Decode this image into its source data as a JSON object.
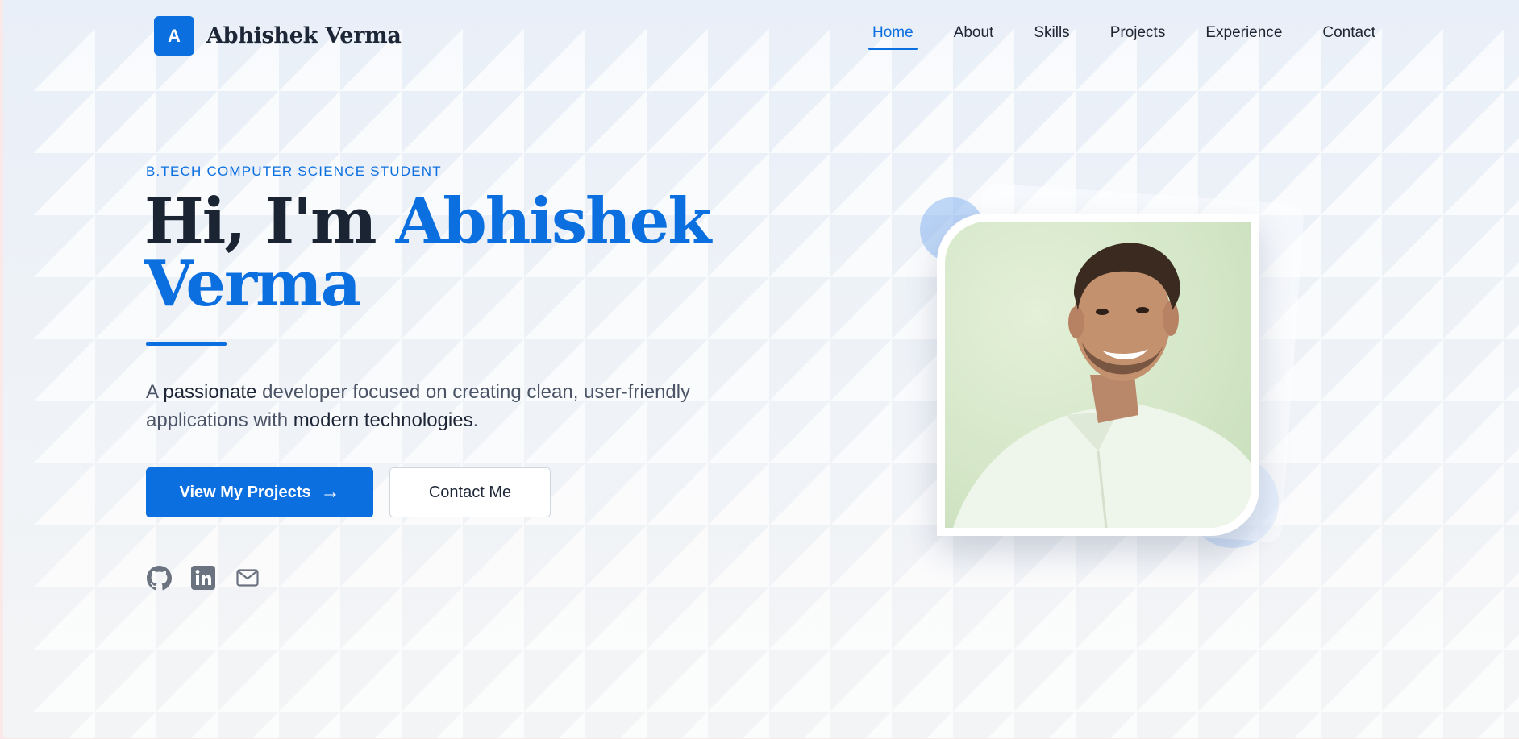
{
  "brand": {
    "logo_letter": "A",
    "name": "Abhishek Verma"
  },
  "nav": {
    "items": [
      {
        "label": "Home",
        "active": true
      },
      {
        "label": "About",
        "active": false
      },
      {
        "label": "Skills",
        "active": false
      },
      {
        "label": "Projects",
        "active": false
      },
      {
        "label": "Experience",
        "active": false
      },
      {
        "label": "Contact",
        "active": false
      }
    ]
  },
  "hero": {
    "eyebrow": "B.TECH COMPUTER SCIENCE STUDENT",
    "greeting": "Hi, I'm ",
    "name": "Abhishek Verma",
    "lead_parts": {
      "p1": "A ",
      "strong1": "passionate",
      "p2": " developer focused on creating clean, user-friendly applications with ",
      "strong2": "modern technologies",
      "p3": "."
    },
    "primary_button": "View My Projects",
    "secondary_button": "Contact Me",
    "socials": [
      {
        "icon": "github-icon"
      },
      {
        "icon": "linkedin-icon"
      },
      {
        "icon": "mail-icon"
      }
    ]
  },
  "colors": {
    "accent": "#0b6fe0",
    "heading": "#1b2433",
    "body": "#4a5466"
  }
}
